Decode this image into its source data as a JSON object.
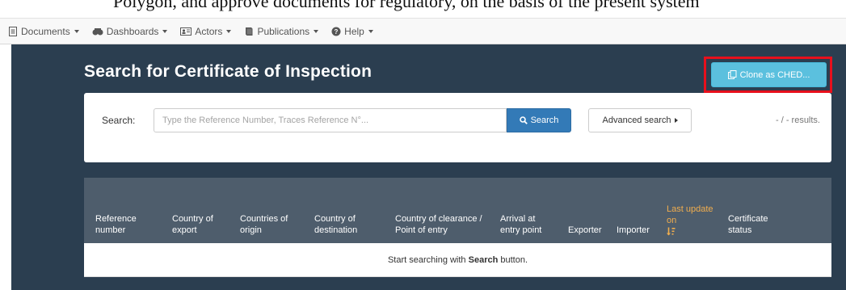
{
  "header_text": "Polygon, and approve documents for regulatory, on the basis of the present system",
  "nav": [
    {
      "label": "Documents",
      "icon": "document-icon"
    },
    {
      "label": "Dashboards",
      "icon": "dashboard-icon"
    },
    {
      "label": "Actors",
      "icon": "id-card-icon"
    },
    {
      "label": "Publications",
      "icon": "book-icon"
    },
    {
      "label": "Help",
      "icon": "question-icon"
    }
  ],
  "page": {
    "title": "Search for Certificate of Inspection",
    "clone_label": "Clone as CHED..."
  },
  "search": {
    "label": "Search:",
    "placeholder": "Type the Reference Number, Traces Reference N°...",
    "value": "",
    "button": "Search",
    "advanced": "Advanced search",
    "results": "- / - results."
  },
  "table": {
    "columns": [
      "Reference number",
      "Country of export",
      "Countries of origin",
      "Country of destination",
      "Country of clearance / Point of entry",
      "Arrival at entry point",
      "Exporter",
      "Importer",
      "Last update on",
      "Certificate status"
    ],
    "empty_prefix": "Start searching with ",
    "empty_bold": "Search",
    "empty_suffix": " button."
  },
  "colors": {
    "main_bg": "#2b3e50",
    "table_header": "#4e5d6c",
    "clone_button": "#5bc0de",
    "search_button": "#337ab7",
    "highlight_border": "#e8101c",
    "sort_active": "#f0ad4e"
  }
}
